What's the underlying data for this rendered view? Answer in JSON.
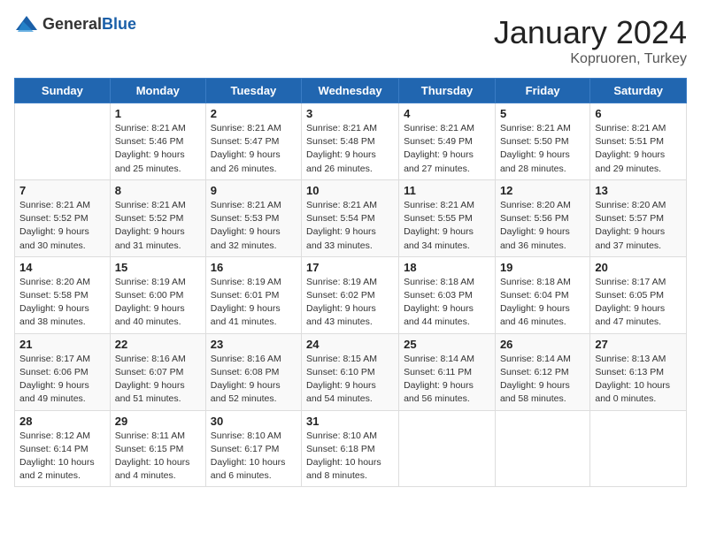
{
  "header": {
    "logo_general": "General",
    "logo_blue": "Blue",
    "month_title": "January 2024",
    "location": "Kopruoren, Turkey"
  },
  "days_of_week": [
    "Sunday",
    "Monday",
    "Tuesday",
    "Wednesday",
    "Thursday",
    "Friday",
    "Saturday"
  ],
  "weeks": [
    [
      {
        "day": "",
        "info": ""
      },
      {
        "day": "1",
        "info": "Sunrise: 8:21 AM\nSunset: 5:46 PM\nDaylight: 9 hours\nand 25 minutes."
      },
      {
        "day": "2",
        "info": "Sunrise: 8:21 AM\nSunset: 5:47 PM\nDaylight: 9 hours\nand 26 minutes."
      },
      {
        "day": "3",
        "info": "Sunrise: 8:21 AM\nSunset: 5:48 PM\nDaylight: 9 hours\nand 26 minutes."
      },
      {
        "day": "4",
        "info": "Sunrise: 8:21 AM\nSunset: 5:49 PM\nDaylight: 9 hours\nand 27 minutes."
      },
      {
        "day": "5",
        "info": "Sunrise: 8:21 AM\nSunset: 5:50 PM\nDaylight: 9 hours\nand 28 minutes."
      },
      {
        "day": "6",
        "info": "Sunrise: 8:21 AM\nSunset: 5:51 PM\nDaylight: 9 hours\nand 29 minutes."
      }
    ],
    [
      {
        "day": "7",
        "info": "Sunrise: 8:21 AM\nSunset: 5:52 PM\nDaylight: 9 hours\nand 30 minutes."
      },
      {
        "day": "8",
        "info": "Sunrise: 8:21 AM\nSunset: 5:52 PM\nDaylight: 9 hours\nand 31 minutes."
      },
      {
        "day": "9",
        "info": "Sunrise: 8:21 AM\nSunset: 5:53 PM\nDaylight: 9 hours\nand 32 minutes."
      },
      {
        "day": "10",
        "info": "Sunrise: 8:21 AM\nSunset: 5:54 PM\nDaylight: 9 hours\nand 33 minutes."
      },
      {
        "day": "11",
        "info": "Sunrise: 8:21 AM\nSunset: 5:55 PM\nDaylight: 9 hours\nand 34 minutes."
      },
      {
        "day": "12",
        "info": "Sunrise: 8:20 AM\nSunset: 5:56 PM\nDaylight: 9 hours\nand 36 minutes."
      },
      {
        "day": "13",
        "info": "Sunrise: 8:20 AM\nSunset: 5:57 PM\nDaylight: 9 hours\nand 37 minutes."
      }
    ],
    [
      {
        "day": "14",
        "info": "Sunrise: 8:20 AM\nSunset: 5:58 PM\nDaylight: 9 hours\nand 38 minutes."
      },
      {
        "day": "15",
        "info": "Sunrise: 8:19 AM\nSunset: 6:00 PM\nDaylight: 9 hours\nand 40 minutes."
      },
      {
        "day": "16",
        "info": "Sunrise: 8:19 AM\nSunset: 6:01 PM\nDaylight: 9 hours\nand 41 minutes."
      },
      {
        "day": "17",
        "info": "Sunrise: 8:19 AM\nSunset: 6:02 PM\nDaylight: 9 hours\nand 43 minutes."
      },
      {
        "day": "18",
        "info": "Sunrise: 8:18 AM\nSunset: 6:03 PM\nDaylight: 9 hours\nand 44 minutes."
      },
      {
        "day": "19",
        "info": "Sunrise: 8:18 AM\nSunset: 6:04 PM\nDaylight: 9 hours\nand 46 minutes."
      },
      {
        "day": "20",
        "info": "Sunrise: 8:17 AM\nSunset: 6:05 PM\nDaylight: 9 hours\nand 47 minutes."
      }
    ],
    [
      {
        "day": "21",
        "info": "Sunrise: 8:17 AM\nSunset: 6:06 PM\nDaylight: 9 hours\nand 49 minutes."
      },
      {
        "day": "22",
        "info": "Sunrise: 8:16 AM\nSunset: 6:07 PM\nDaylight: 9 hours\nand 51 minutes."
      },
      {
        "day": "23",
        "info": "Sunrise: 8:16 AM\nSunset: 6:08 PM\nDaylight: 9 hours\nand 52 minutes."
      },
      {
        "day": "24",
        "info": "Sunrise: 8:15 AM\nSunset: 6:10 PM\nDaylight: 9 hours\nand 54 minutes."
      },
      {
        "day": "25",
        "info": "Sunrise: 8:14 AM\nSunset: 6:11 PM\nDaylight: 9 hours\nand 56 minutes."
      },
      {
        "day": "26",
        "info": "Sunrise: 8:14 AM\nSunset: 6:12 PM\nDaylight: 9 hours\nand 58 minutes."
      },
      {
        "day": "27",
        "info": "Sunrise: 8:13 AM\nSunset: 6:13 PM\nDaylight: 10 hours\nand 0 minutes."
      }
    ],
    [
      {
        "day": "28",
        "info": "Sunrise: 8:12 AM\nSunset: 6:14 PM\nDaylight: 10 hours\nand 2 minutes."
      },
      {
        "day": "29",
        "info": "Sunrise: 8:11 AM\nSunset: 6:15 PM\nDaylight: 10 hours\nand 4 minutes."
      },
      {
        "day": "30",
        "info": "Sunrise: 8:10 AM\nSunset: 6:17 PM\nDaylight: 10 hours\nand 6 minutes."
      },
      {
        "day": "31",
        "info": "Sunrise: 8:10 AM\nSunset: 6:18 PM\nDaylight: 10 hours\nand 8 minutes."
      },
      {
        "day": "",
        "info": ""
      },
      {
        "day": "",
        "info": ""
      },
      {
        "day": "",
        "info": ""
      }
    ]
  ]
}
